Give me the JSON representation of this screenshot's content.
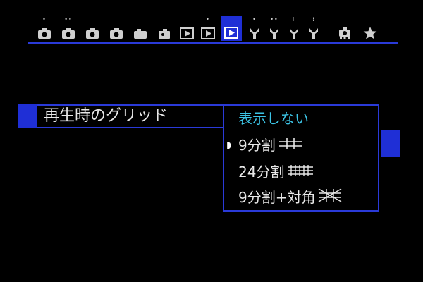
{
  "menu_tabs": [
    {
      "id": "shoot1",
      "icon": "camera-icon",
      "dots": "•"
    },
    {
      "id": "shoot2",
      "icon": "camera-icon",
      "dots": "••"
    },
    {
      "id": "shoot3",
      "icon": "camera-icon",
      "dots": "⁝"
    },
    {
      "id": "shoot4",
      "icon": "camera-icon",
      "dots": "⁞"
    },
    {
      "id": "shoot5",
      "icon": "camera-icon",
      "dots": ""
    },
    {
      "id": "shoot6",
      "icon": "camera-small-icon",
      "dots": ""
    },
    {
      "id": "play1",
      "icon": "playback-icon",
      "dots": ""
    },
    {
      "id": "play2",
      "icon": "playback-icon",
      "dots": "•"
    },
    {
      "id": "play3",
      "icon": "playback-icon",
      "dots": "⁝",
      "active": true
    },
    {
      "id": "tool1",
      "icon": "wrench-icon",
      "dots": "•"
    },
    {
      "id": "tool2",
      "icon": "wrench-icon",
      "dots": "••"
    },
    {
      "id": "tool3",
      "icon": "wrench-icon",
      "dots": "⁝"
    },
    {
      "id": "tool4",
      "icon": "wrench-icon",
      "dots": "⁞"
    },
    {
      "id": "custom",
      "icon": "custom-functions-icon",
      "dots": ""
    },
    {
      "id": "mymenu",
      "icon": "star-icon",
      "dots": ""
    }
  ],
  "setting": {
    "label": "再生時のグリッド"
  },
  "options": {
    "current_value": "表示しない",
    "items": [
      {
        "label": "9分割",
        "grid": "grid-3x3-icon",
        "selected": true
      },
      {
        "label": "24分割",
        "grid": "grid-6x4-icon",
        "selected": false
      },
      {
        "label": "9分割+対角",
        "grid": "grid-diagonal-icon",
        "selected": false
      }
    ]
  },
  "colors": {
    "accent_blue": "#1f2fd6",
    "current_value": "#3cc4e6",
    "text": "#e8e8e8",
    "background": "#000000"
  }
}
